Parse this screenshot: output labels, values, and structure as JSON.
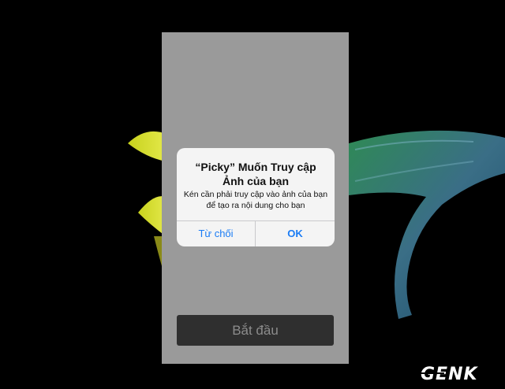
{
  "alert": {
    "title": "“Picky” Muốn Truy cập Ảnh của bạn",
    "message": "Kén cần phải truy cập vào ảnh của bạn để tạo ra nội dung cho bạn",
    "cancel_label": "Từ chối",
    "ok_label": "OK"
  },
  "app": {
    "start_label": "Bắt đầu"
  },
  "watermark": {
    "text": "GENK"
  },
  "colors": {
    "phone_background": "#9a9a9a",
    "alert_background": "#f4f4f4",
    "alert_button_text": "#1a7cf5",
    "start_button_background": "#2f2f2f"
  }
}
